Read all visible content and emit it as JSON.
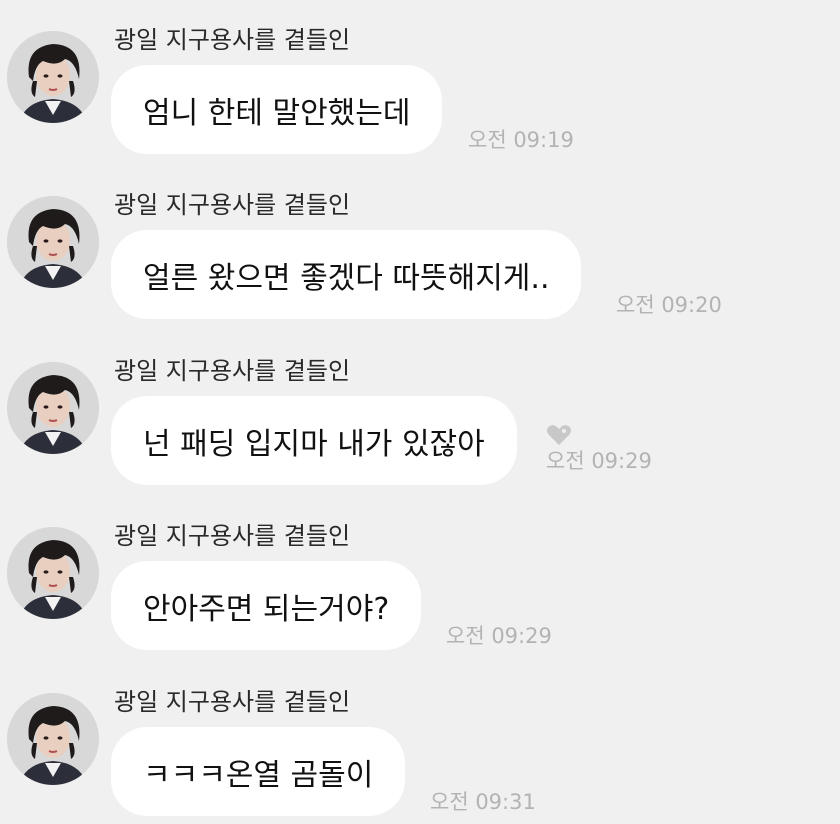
{
  "messages": [
    {
      "sender": "광일 지구용사를 곁들인",
      "text": "엄니 한테 말안했는데",
      "time": "오전 09:19",
      "reaction": null
    },
    {
      "sender": "광일 지구용사를 곁들인",
      "text": "얼른 왔으면 좋겠다 따뜻해지게..",
      "time": "오전 09:20",
      "reaction": null
    },
    {
      "sender": "광일 지구용사를 곁들인",
      "text": "넌 패딩 입지마 내가 있잖아",
      "time": "오전 09:29",
      "reaction": "heart-icon"
    },
    {
      "sender": "광일 지구용사를 곁들인",
      "text": "안아주면 되는거야?",
      "time": "오전 09:29",
      "reaction": null
    },
    {
      "sender": "광일 지구용사를 곁들인",
      "text": "ㅋㅋㅋ온열 곰돌이",
      "time": "오전 09:31",
      "reaction": null
    }
  ],
  "colors": {
    "background": "#f0f0f0",
    "bubble": "#ffffff",
    "time": "#b3b3b3",
    "heart": "#c8c8c8"
  }
}
